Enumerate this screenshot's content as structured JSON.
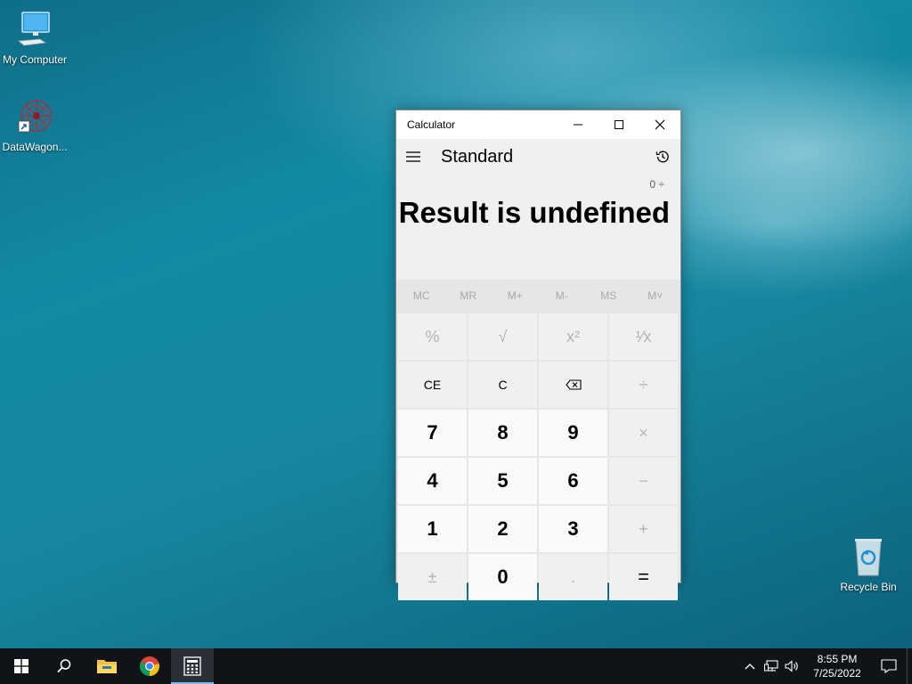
{
  "desktop": {
    "icons": [
      {
        "label": "My Computer",
        "icon": "computer-icon"
      },
      {
        "label": "DataWagon...",
        "icon": "datawagon-icon"
      },
      {
        "label": "Recycle Bin",
        "icon": "recycle-bin-icon"
      }
    ]
  },
  "calculator": {
    "window_title": "Calculator",
    "mode": "Standard",
    "expression": "0 ÷",
    "result": "Result is undefined",
    "memory": [
      "MC",
      "MR",
      "M+",
      "M-",
      "MS",
      "M˅"
    ],
    "keys": [
      {
        "label": "%",
        "enabled": false
      },
      {
        "label": "√",
        "enabled": false
      },
      {
        "label": "x²",
        "enabled": false
      },
      {
        "label": "¹⁄x",
        "enabled": false
      },
      {
        "label": "CE",
        "enabled": true
      },
      {
        "label": "C",
        "enabled": true
      },
      {
        "label": "⌫",
        "enabled": true
      },
      {
        "label": "÷",
        "enabled": false
      },
      {
        "label": "7",
        "enabled": true
      },
      {
        "label": "8",
        "enabled": true
      },
      {
        "label": "9",
        "enabled": true
      },
      {
        "label": "×",
        "enabled": false
      },
      {
        "label": "4",
        "enabled": true
      },
      {
        "label": "5",
        "enabled": true
      },
      {
        "label": "6",
        "enabled": true
      },
      {
        "label": "−",
        "enabled": false
      },
      {
        "label": "1",
        "enabled": true
      },
      {
        "label": "2",
        "enabled": true
      },
      {
        "label": "3",
        "enabled": true
      },
      {
        "label": "+",
        "enabled": false
      },
      {
        "label": "±",
        "enabled": false
      },
      {
        "label": "0",
        "enabled": true
      },
      {
        "label": ".",
        "enabled": false
      },
      {
        "label": "=",
        "enabled": true
      }
    ]
  },
  "taskbar": {
    "items": [
      "start-icon",
      "search-icon",
      "file-explorer-icon",
      "chrome-icon",
      "calculator-icon"
    ],
    "active_item": "calculator-icon",
    "clock": {
      "time": "8:55 PM",
      "date": "7/25/2022"
    }
  },
  "colors": {
    "taskbar": "#101317",
    "accent": "#76b9ed"
  }
}
